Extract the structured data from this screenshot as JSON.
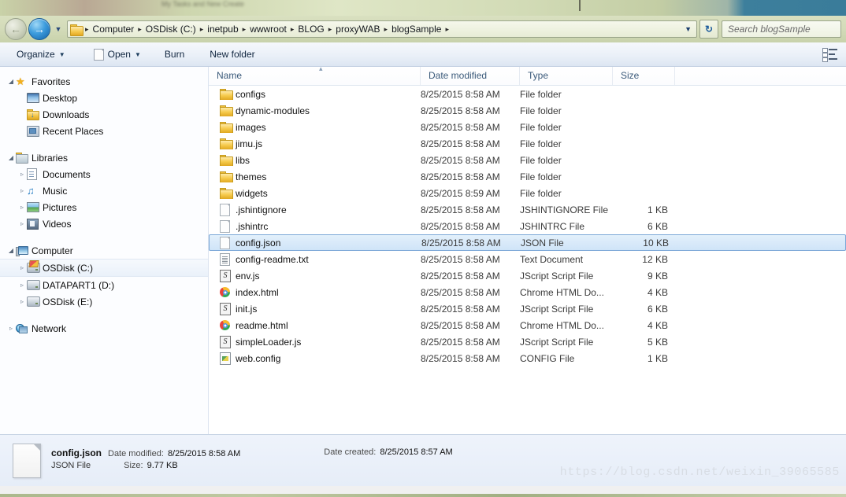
{
  "desktop": {
    "blurred_title_hint": "My Tasks and New Create"
  },
  "address_bar": {
    "back_label": "Back",
    "forward_label": "Forward",
    "history_dropdown_label": "Recent pages",
    "folder_icon": "folder-icon",
    "breadcrumbs": [
      "Computer",
      "OSDisk (C:)",
      "inetpub",
      "wwwroot",
      "BLOG",
      "proxyWAB",
      "blogSample"
    ],
    "separator": "▸",
    "path_dropdown": "▼",
    "refresh_label": "↻",
    "search_placeholder": "Search blogSample"
  },
  "toolbar": {
    "organize_label": "Organize",
    "open_label": "Open",
    "burn_label": "Burn",
    "new_folder_label": "New folder",
    "caret": "▼",
    "view_icon": "change-view-icon"
  },
  "nav_pane": {
    "groups": [
      {
        "name": "Favorites",
        "icon": "star-icon",
        "expander": "◢",
        "items": [
          {
            "label": "Desktop",
            "icon": "desktop-icon",
            "expander": ""
          },
          {
            "label": "Downloads",
            "icon": "downloads-folder-icon",
            "expander": ""
          },
          {
            "label": "Recent Places",
            "icon": "recent-places-icon",
            "expander": ""
          }
        ]
      },
      {
        "name": "Libraries",
        "icon": "libraries-icon",
        "expander": "◢",
        "items": [
          {
            "label": "Documents",
            "icon": "documents-icon",
            "expander": "▹"
          },
          {
            "label": "Music",
            "icon": "music-icon",
            "expander": "▹"
          },
          {
            "label": "Pictures",
            "icon": "pictures-icon",
            "expander": "▹"
          },
          {
            "label": "Videos",
            "icon": "videos-icon",
            "expander": "▹"
          }
        ]
      },
      {
        "name": "Computer",
        "icon": "computer-icon",
        "expander": "◢",
        "items": [
          {
            "label": "OSDisk (C:)",
            "icon": "windows-drive-icon",
            "expander": "▹",
            "selected": true
          },
          {
            "label": "DATAPART1 (D:)",
            "icon": "drive-icon",
            "expander": "▹"
          },
          {
            "label": "OSDisk (E:)",
            "icon": "drive-icon",
            "expander": "▹"
          }
        ]
      },
      {
        "name": "Network",
        "icon": "network-icon",
        "expander": "▹",
        "items": []
      }
    ]
  },
  "file_list": {
    "columns": [
      "Name",
      "Date modified",
      "Type",
      "Size"
    ],
    "sort_indicator": "▴",
    "rows": [
      {
        "name": "configs",
        "date": "8/25/2015 8:58 AM",
        "type": "File folder",
        "size": "",
        "icon": "folder-icon"
      },
      {
        "name": "dynamic-modules",
        "date": "8/25/2015 8:58 AM",
        "type": "File folder",
        "size": "",
        "icon": "folder-icon"
      },
      {
        "name": "images",
        "date": "8/25/2015 8:58 AM",
        "type": "File folder",
        "size": "",
        "icon": "folder-icon"
      },
      {
        "name": "jimu.js",
        "date": "8/25/2015 8:58 AM",
        "type": "File folder",
        "size": "",
        "icon": "folder-icon"
      },
      {
        "name": "libs",
        "date": "8/25/2015 8:58 AM",
        "type": "File folder",
        "size": "",
        "icon": "folder-icon"
      },
      {
        "name": "themes",
        "date": "8/25/2015 8:58 AM",
        "type": "File folder",
        "size": "",
        "icon": "folder-icon"
      },
      {
        "name": "widgets",
        "date": "8/25/2015 8:59 AM",
        "type": "File folder",
        "size": "",
        "icon": "folder-icon"
      },
      {
        "name": ".jshintignore",
        "date": "8/25/2015 8:58 AM",
        "type": "JSHINTIGNORE File",
        "size": "1 KB",
        "icon": "blank-file-icon"
      },
      {
        "name": ".jshintrc",
        "date": "8/25/2015 8:58 AM",
        "type": "JSHINTRC File",
        "size": "6 KB",
        "icon": "blank-file-icon"
      },
      {
        "name": "config.json",
        "date": "8/25/2015 8:58 AM",
        "type": "JSON File",
        "size": "10 KB",
        "icon": "blank-file-icon",
        "selected": true
      },
      {
        "name": "config-readme.txt",
        "date": "8/25/2015 8:58 AM",
        "type": "Text Document",
        "size": "12 KB",
        "icon": "text-file-icon"
      },
      {
        "name": "env.js",
        "date": "8/25/2015 8:58 AM",
        "type": "JScript Script File",
        "size": "9 KB",
        "icon": "jscript-file-icon"
      },
      {
        "name": "index.html",
        "date": "8/25/2015 8:58 AM",
        "type": "Chrome HTML Do...",
        "size": "4 KB",
        "icon": "chrome-html-icon"
      },
      {
        "name": "init.js",
        "date": "8/25/2015 8:58 AM",
        "type": "JScript Script File",
        "size": "6 KB",
        "icon": "jscript-file-icon"
      },
      {
        "name": "readme.html",
        "date": "8/25/2015 8:58 AM",
        "type": "Chrome HTML Do...",
        "size": "4 KB",
        "icon": "chrome-html-icon"
      },
      {
        "name": "simpleLoader.js",
        "date": "8/25/2015 8:58 AM",
        "type": "JScript Script File",
        "size": "5 KB",
        "icon": "jscript-file-icon"
      },
      {
        "name": "web.config",
        "date": "8/25/2015 8:58 AM",
        "type": "CONFIG File",
        "size": "1 KB",
        "icon": "config-file-icon"
      }
    ]
  },
  "details_pane": {
    "file_name": "config.json",
    "file_type": "JSON File",
    "date_modified_label": "Date modified:",
    "date_modified_value": "8/25/2015 8:58 AM",
    "size_label": "Size:",
    "size_value": "9.77 KB",
    "date_created_label": "Date created:",
    "date_created_value": "8/25/2015 8:57 AM",
    "icon": "json-file-icon"
  },
  "watermark": {
    "text": "https://blog.csdn.net/weixin_39065585"
  },
  "colors": {
    "selection_blue": "#cfe4f8",
    "selection_border": "#7ba7d7",
    "address_bar_green": "#d3dbb9",
    "toolbar_blue": "#eaf0f8",
    "folder_yellow": "#f3c545"
  }
}
